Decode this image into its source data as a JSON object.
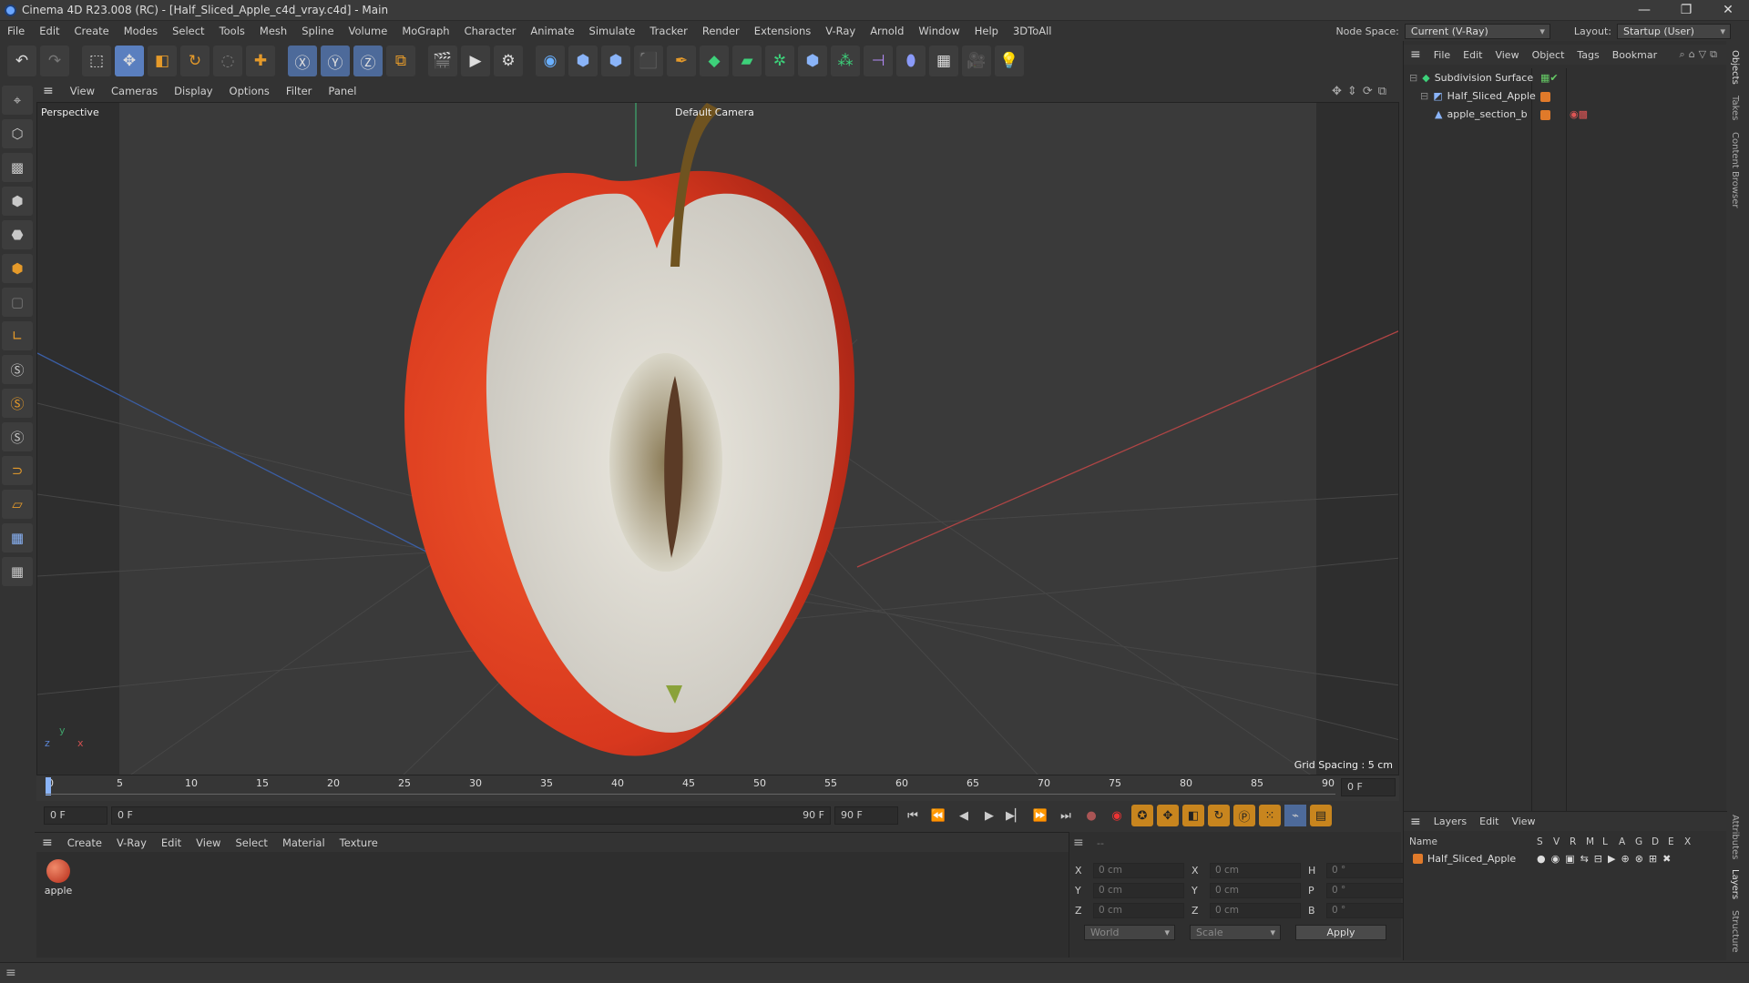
{
  "window": {
    "title": "Cinema 4D R23.008 (RC) - [Half_Sliced_Apple_c4d_vray.c4d] - Main",
    "min": "—",
    "max": "❐",
    "close": "✕"
  },
  "menubar": {
    "items": [
      "File",
      "Edit",
      "Create",
      "Modes",
      "Select",
      "Tools",
      "Mesh",
      "Spline",
      "Volume",
      "MoGraph",
      "Character",
      "Animate",
      "Simulate",
      "Tracker",
      "Render",
      "Extensions",
      "V-Ray",
      "Arnold",
      "Window",
      "Help",
      "3DToAll"
    ],
    "node_space_label": "Node Space:",
    "node_space_value": "Current (V-Ray)",
    "layout_label": "Layout:",
    "layout_value": "Startup (User)"
  },
  "viewport": {
    "menu": [
      "View",
      "Cameras",
      "Display",
      "Options",
      "Filter",
      "Panel"
    ],
    "label": "Perspective",
    "camera": "Default Camera",
    "grid_spacing": "Grid Spacing : 5 cm",
    "axis_y": "y",
    "axis_x": "x",
    "axis_z": "z"
  },
  "timeline": {
    "ticks": [
      "0",
      "5",
      "10",
      "15",
      "20",
      "25",
      "30",
      "35",
      "40",
      "45",
      "50",
      "55",
      "60",
      "65",
      "70",
      "75",
      "80",
      "85",
      "90"
    ],
    "current_frame": "0 F"
  },
  "transport": {
    "start": "0 F",
    "range_start": "0 F",
    "range_end": "90 F",
    "end": "90 F"
  },
  "material": {
    "menu": [
      "Create",
      "V-Ray",
      "Edit",
      "View",
      "Select",
      "Material",
      "Texture"
    ],
    "name": "apple"
  },
  "coords": {
    "col1": [
      "X",
      "Y",
      "Z"
    ],
    "col2": [
      "X",
      "Y",
      "Z"
    ],
    "col3": [
      "H",
      "P",
      "B"
    ],
    "pos": [
      "0 cm",
      "0 cm",
      "0 cm"
    ],
    "size": [
      "0 cm",
      "0 cm",
      "0 cm"
    ],
    "rot": [
      "0 °",
      "0 °",
      "0 °"
    ],
    "dash": "--",
    "mode": "World",
    "scale": "Scale",
    "apply": "Apply"
  },
  "objects": {
    "menu": [
      "File",
      "Edit",
      "View",
      "Object",
      "Tags",
      "Bookmar"
    ],
    "items": [
      "Subdivision Surface",
      "Half_Sliced_Apple",
      "apple_section_b"
    ]
  },
  "layers": {
    "menu": [
      "Layers",
      "Edit",
      "View"
    ],
    "header_name": "Name",
    "header_cols": [
      "S",
      "V",
      "R",
      "M",
      "L",
      "A",
      "G",
      "D",
      "E",
      "X"
    ],
    "row": "Half_Sliced_Apple"
  },
  "sidetabs": [
    "Objects",
    "Takes",
    "Content Browser",
    "Attributes",
    "Layers",
    "Structure"
  ],
  "colors": {
    "accent": "#c8851e",
    "select_blue": "#5a7fbf",
    "apple_red": "#d8381e"
  }
}
